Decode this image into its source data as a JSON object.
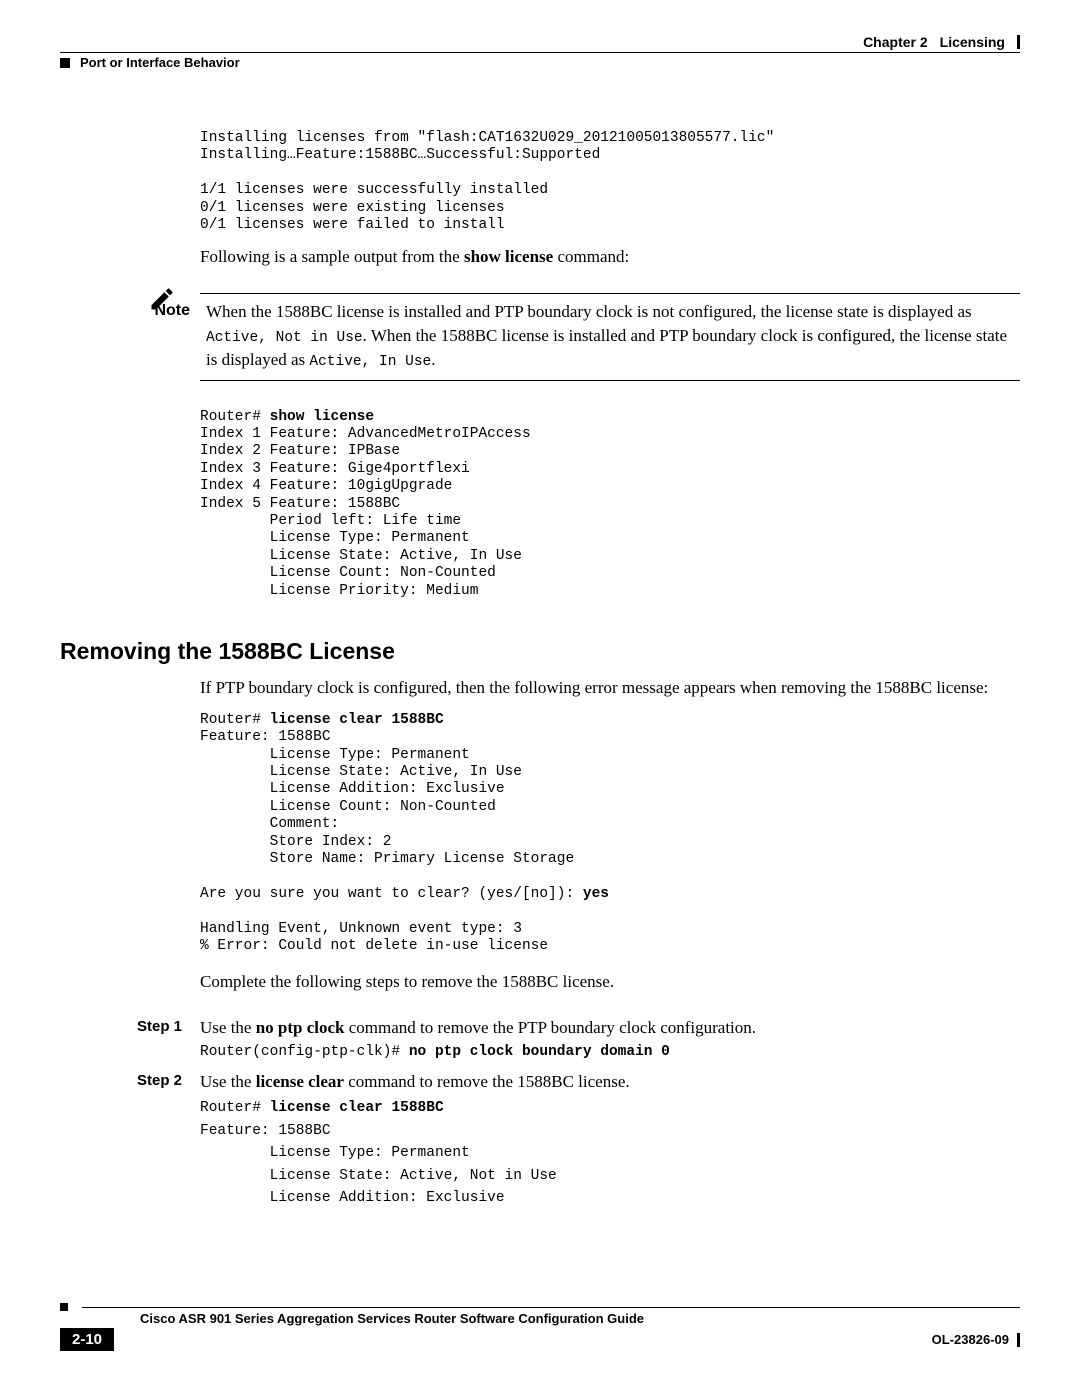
{
  "header": {
    "chapter_label": "Chapter 2",
    "chapter_title": "Licensing",
    "section": "Port or Interface Behavior"
  },
  "code_install": "Installing licenses from \"flash:CAT1632U029_20121005013805577.lic\"\nInstalling…Feature:1588BC…Successful:Supported\n\n1/1 licenses were successfully installed\n0/1 licenses were existing licenses\n0/1 licenses were failed to install",
  "para_intro": {
    "pre": "Following is a sample output from the ",
    "cmd": "show license",
    "post": " command:"
  },
  "note": {
    "label": "Note",
    "text_pre": "When the 1588BC license is installed and PTP boundary clock is not configured, the license state is displayed as ",
    "code1": "Active, Not in Use",
    "text_mid": ". When the 1588BC license is installed and PTP boundary clock is configured, the license state is displayed as ",
    "code2": "Active, In Use",
    "text_post": "."
  },
  "code_show": {
    "prompt": "Router# ",
    "cmd": "show license",
    "body": "Index 1 Feature: AdvancedMetroIPAccess\nIndex 2 Feature: IPBase\nIndex 3 Feature: Gige4portflexi\nIndex 4 Feature: 10gigUpgrade\nIndex 5 Feature: 1588BC\n        Period left: Life time\n        License Type: Permanent\n        License State: Active, In Use\n        License Count: Non-Counted\n        License Priority: Medium"
  },
  "h2": "Removing the 1588BC License",
  "para_remove": "If PTP boundary clock is configured, then the following error message appears when removing the 1588BC license:",
  "code_clear": {
    "prompt": "Router# ",
    "cmd": "license clear 1588BC",
    "body": "Feature: 1588BC\n        License Type: Permanent\n        License State: Active, In Use\n        License Addition: Exclusive\n        License Count: Non-Counted\n        Comment:\n        Store Index: 2\n        Store Name: Primary License Storage\n\nAre you sure you want to clear? (yes/[no]): ",
    "yes": "yes",
    "tail": "\n\nHandling Event, Unknown event type: 3\n% Error: Could not delete in-use license"
  },
  "para_steps": "Complete the following steps to remove the 1588BC license.",
  "step1": {
    "label": "Step 1",
    "pre": "Use the ",
    "cmd": "no ptp clock",
    "post": " command to remove the PTP boundary clock configuration.",
    "code_prompt": "Router(config-ptp-clk)# ",
    "code_cmd": "no ptp clock boundary domain 0"
  },
  "step2": {
    "label": "Step 2",
    "pre": "Use the ",
    "cmd": "license clear",
    "post": " command to remove the 1588BC license.",
    "code_prompt": "Router# ",
    "code_cmd": "license clear 1588BC",
    "code_body": "Feature: 1588BC\n        License Type: Permanent\n        License State: Active, Not in Use\n        License Addition: Exclusive"
  },
  "footer": {
    "guide": "Cisco ASR 901 Series Aggregation Services Router Software Configuration Guide",
    "page": "2-10",
    "doc": "OL-23826-09"
  }
}
